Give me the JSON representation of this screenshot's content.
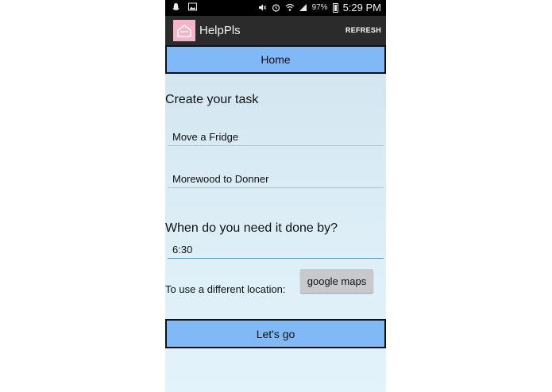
{
  "status_bar": {
    "battery_percent": "97%",
    "time": "5:29 PM",
    "icons": [
      "snapchat-icon",
      "gallery-icon",
      "mute-icon",
      "alarm-icon",
      "wifi-icon",
      "signal-icon",
      "battery-icon"
    ]
  },
  "action_bar": {
    "title": "HelpPls",
    "refresh_label": "REFRESH",
    "logo_color": "#f4b5c6",
    "background": "#2b2b2b"
  },
  "home_label": "Home",
  "form": {
    "heading": "Create your task",
    "task_value": "Move a Fridge",
    "location_value": "Morewood to Donner",
    "time_question": "When do you need it done by?",
    "time_value": "6:30",
    "location_prompt": "To use a different location:",
    "maps_button_label": "google maps",
    "submit_label": "Let's go"
  },
  "colors": {
    "accent_button": "#80b9f6",
    "input_focus_underline": "#3aa0d0"
  }
}
